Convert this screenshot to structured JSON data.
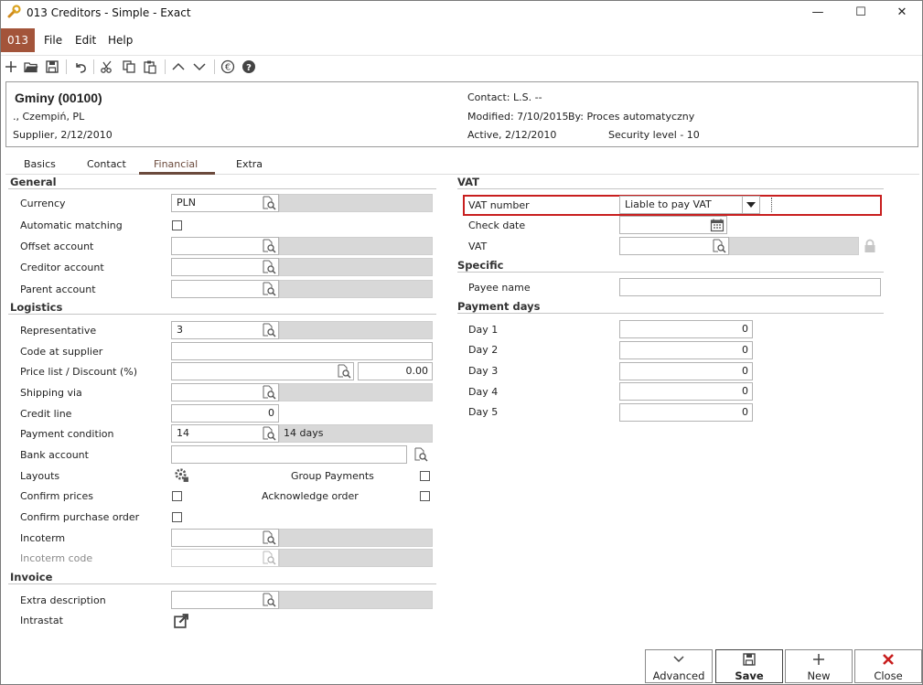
{
  "window": {
    "title": "013 Creditors - Simple - Exact",
    "minimize": "—",
    "maximize": "☐",
    "close": "✕"
  },
  "menu": {
    "company": "013",
    "file": "File",
    "edit": "Edit",
    "help": "Help"
  },
  "header": {
    "name": "Gminy (00100)",
    "address": "., Czempiń, PL",
    "type_date": "Supplier, 2/12/2010",
    "contact": "Contact: L.S. --",
    "modified": "Modified: 7/10/2015",
    "modified_by": "By: Proces automatyczny",
    "active": "Active, 2/12/2010",
    "security": "Security level - 10"
  },
  "tabs": [
    "Basics",
    "Contact",
    "Financial",
    "Extra"
  ],
  "active_tab": "Financial",
  "left": {
    "general_title": "General",
    "currency_label": "Currency",
    "currency_value": "PLN",
    "automatic_matching_label": "Automatic matching",
    "offset_account_label": "Offset account",
    "creditor_account_label": "Creditor account",
    "parent_account_label": "Parent account",
    "logistics_title": "Logistics",
    "representative_label": "Representative",
    "representative_value": "3",
    "code_at_supplier_label": "Code at supplier",
    "price_list_label": "Price list / Discount (%)",
    "discount_value": "0.00",
    "shipping_via_label": "Shipping via",
    "credit_line_label": "Credit line",
    "credit_line_value": "0",
    "payment_condition_label": "Payment condition",
    "payment_condition_value": "14",
    "payment_condition_desc": "14 days",
    "bank_account_label": "Bank account",
    "layouts_label": "Layouts",
    "group_payments_label": "Group Payments",
    "confirm_prices_label": "Confirm prices",
    "acknowledge_order_label": "Acknowledge order",
    "confirm_po_label": "Confirm purchase order",
    "incoterm_label": "Incoterm",
    "incoterm_code_label": "Incoterm code",
    "invoice_title": "Invoice",
    "extra_description_label": "Extra description",
    "intrastat_label": "Intrastat"
  },
  "right": {
    "vat_title": "VAT",
    "vat_number_label": "VAT number",
    "vat_number_value": "Liable to pay VAT",
    "check_date_label": "Check date",
    "vat_label": "VAT",
    "specific_title": "Specific",
    "payee_name_label": "Payee name",
    "payment_days_title": "Payment days",
    "days": [
      {
        "label": "Day 1",
        "value": "0"
      },
      {
        "label": "Day 2",
        "value": "0"
      },
      {
        "label": "Day 3",
        "value": "0"
      },
      {
        "label": "Day 4",
        "value": "0"
      },
      {
        "label": "Day 5",
        "value": "0"
      }
    ]
  },
  "buttons": {
    "advanced": "Advanced",
    "save": "Save",
    "new": "New",
    "close": "Close"
  },
  "colors": {
    "company_badge": "#a3543a",
    "highlight": "#c81e1e",
    "close_icon": "#c81e1e"
  }
}
